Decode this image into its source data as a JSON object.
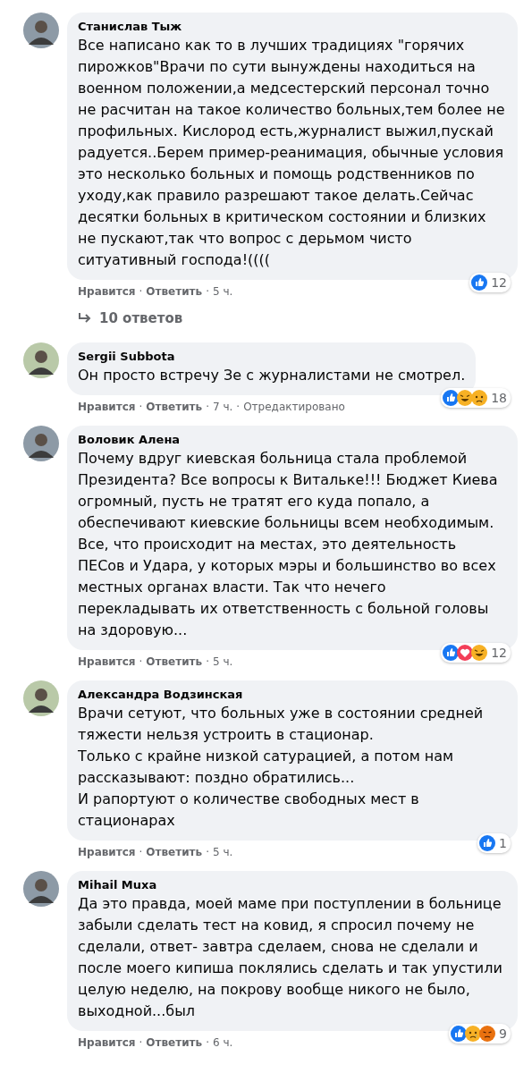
{
  "comments": [
    {
      "author": "Станислав Тыж",
      "text": "Все написано как то в лучших традициях \"горячих пирожков\"Врачи по сути вынуждены находиться на военном положении,а медсестерский персонал точно не расчитан на такое количество больных,тем более не профильных. Кислород есть,журналист выжил,пускай радуется..Берем пример-реанимация, обычные условия это несколько больных и помощь родственников по уходу,как правило разрешают такое делать.Сейчас десятки больных в критическом состоянии и близких не пускают,так что вопрос с дерьмом чисто ситуативный господа!((((",
      "reactions": [
        {
          "kind": "like"
        }
      ],
      "reaction_count": "12",
      "like": "Нравится",
      "separator": "·",
      "reply": "Ответить",
      "time": "5 ч.",
      "replies": "10 ответов"
    },
    {
      "author": "Sergii Subbota",
      "text": "Он просто встречу Зе с журналистами не смотрел.",
      "reactions": [
        {
          "kind": "like"
        },
        {
          "kind": "haha"
        },
        {
          "kind": "sad"
        }
      ],
      "reaction_count": "18",
      "like": "Нравится",
      "separator": "·",
      "reply": "Ответить",
      "time": "7 ч.",
      "edited": "Отредактировано"
    },
    {
      "author": "Воловик Алена",
      "text": "Почему вдруг киевская больница стала проблемой Президента? Все вопросы к Витальке!!! Бюджет Киева огромный, пусть не тратят его куда попало, а обеспечивают киевские больницы всем необходимым. Все, что происходит на местах, это деятельность ПЕСов и Удара, у которых мэры и большинство во всех местных органах власти. Так что нечего перекладывать их ответственность с больной головы на здоровую...",
      "reactions": [
        {
          "kind": "like"
        },
        {
          "kind": "love"
        },
        {
          "kind": "haha"
        }
      ],
      "reaction_count": "12",
      "like": "Нравится",
      "separator": "·",
      "reply": "Ответить",
      "time": "5 ч."
    },
    {
      "author": "Александра Водзинская",
      "text": "Врачи сетуют, что больных уже в состоянии средней тяжести нельзя устроить в стационар.\nТолько с крайне низкой сатурацией, а потом нам рассказывают: поздно обратились...\nИ рапортуют о количестве свободных мест в стационарах",
      "reactions": [
        {
          "kind": "like"
        }
      ],
      "reaction_count": "1",
      "like": "Нравится",
      "separator": "·",
      "reply": "Ответить",
      "time": "5 ч."
    },
    {
      "author": "Mihail Muxa",
      "text": "Да это правда, моей маме при поступлении в больнице забыли сделать тест на ковид, я спросил почему не сделали, ответ- завтра сделаем, снова не сделали и после моего кипиша поклялись сделать и так упустили целую неделю, на покрову вообще никого не было, выходной...был",
      "reactions": [
        {
          "kind": "like"
        },
        {
          "kind": "sad"
        },
        {
          "kind": "angry"
        }
      ],
      "reaction_count": "9",
      "like": "Нравится",
      "separator": "·",
      "reply": "Ответить",
      "time": "6 ч."
    }
  ]
}
